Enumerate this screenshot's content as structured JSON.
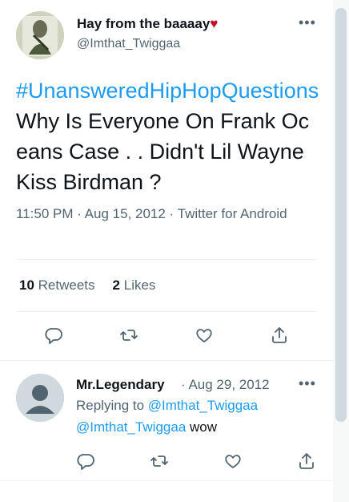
{
  "tweet": {
    "author_name": "Hay from the baaaay",
    "author_emoji": "♥",
    "author_handle": "@Imthat_Twiggaa",
    "more_icon": "more-horizontal-icon",
    "hashtag_line1": "#UnansweredHipHopQuesti",
    "hashtag_line2": "ons",
    "text_rest": " Why Is Everyone On Frank Oceans Case . . Didn't Lil Wayne Kiss Birdman ?",
    "timestamp": "11:50 PM · Aug 15, 2012 · Twitter for Android",
    "retweets_count": "10",
    "retweets_label": "Retweets",
    "likes_count": "2",
    "likes_label": "Likes",
    "actions": [
      "reply-icon",
      "retweet-icon",
      "like-icon",
      "share-icon"
    ]
  },
  "reply": {
    "author_name": "Mr.Legendary",
    "date": "· Aug 29, 2012",
    "replying_to_label": "Replying to",
    "replying_to_handle": "@Imthat_Twiggaa",
    "body_mention": "@Imthat_Twiggaa",
    "body_text": " wow",
    "actions": [
      "reply-icon",
      "retweet-icon",
      "like-icon",
      "share-icon"
    ]
  },
  "colors": {
    "accent": "#1d9bf0",
    "text": "#0f1419",
    "secondary": "#536471",
    "divider": "#eff3f4"
  }
}
